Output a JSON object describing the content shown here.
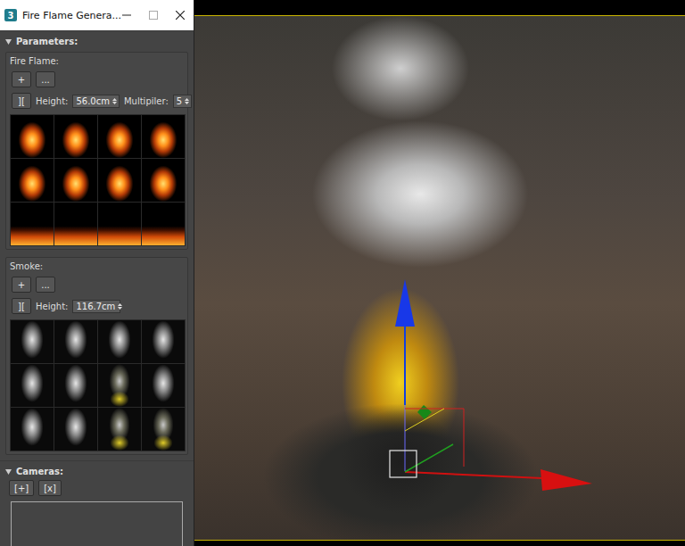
{
  "window": {
    "app_icon": "3",
    "title": "Fire Flame Genera..."
  },
  "parameters": {
    "label": "Parameters:",
    "expanded": true,
    "fire_flame": {
      "label": "Fire Flame:",
      "buttons": [
        "+",
        "..."
      ],
      "link_button": "][",
      "height": {
        "label": "Height:",
        "value": "56.0cm"
      },
      "multiplier": {
        "label": "Multipiler:",
        "value": "5"
      },
      "thumbnails": [
        {
          "kind": "flame"
        },
        {
          "kind": "flame"
        },
        {
          "kind": "flame"
        },
        {
          "kind": "flame"
        },
        {
          "kind": "flame"
        },
        {
          "kind": "flame"
        },
        {
          "kind": "flame"
        },
        {
          "kind": "flame"
        },
        {
          "kind": "strip"
        },
        {
          "kind": "strip"
        },
        {
          "kind": "strip"
        },
        {
          "kind": "strip"
        }
      ]
    },
    "smoke": {
      "label": "Smoke:",
      "buttons": [
        "+",
        "..."
      ],
      "link_button": "][",
      "height": {
        "label": "Height:",
        "value": "116.7cm"
      },
      "thumbnails": [
        {
          "kind": "smoke"
        },
        {
          "kind": "smoke"
        },
        {
          "kind": "smoke"
        },
        {
          "kind": "smoke"
        },
        {
          "kind": "smoke"
        },
        {
          "kind": "smoke"
        },
        {
          "kind": "smoke-yellow"
        },
        {
          "kind": "smoke"
        },
        {
          "kind": "smoke"
        },
        {
          "kind": "smoke"
        },
        {
          "kind": "smoke-yellow"
        },
        {
          "kind": "smoke-yellow"
        }
      ]
    }
  },
  "cameras": {
    "label": "Cameras:",
    "expanded": true,
    "buttons": [
      "[+]",
      "[x]"
    ],
    "items": []
  }
}
